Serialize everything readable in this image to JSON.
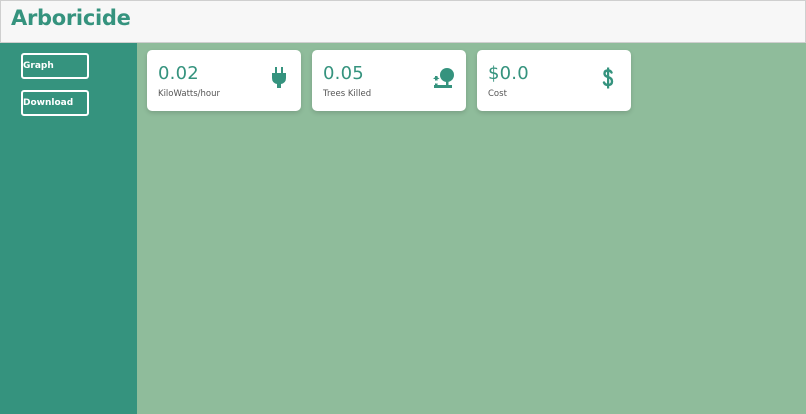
{
  "app": {
    "title": "Arboricide"
  },
  "sidebar": {
    "buttons": [
      {
        "label": "Graph"
      },
      {
        "label": "Download"
      }
    ]
  },
  "cards": [
    {
      "value": "0.02",
      "label": "KiloWatts/hour",
      "icon": "plug-icon"
    },
    {
      "value": "0.05",
      "label": "Trees Killed",
      "icon": "tree-icon"
    },
    {
      "value": "$0.0",
      "label": "Cost",
      "icon": "dollar-icon"
    }
  ],
  "colors": {
    "accent": "#35937e",
    "background": "#8fbc9b",
    "header": "#f7f7f7",
    "card": "#ffffff"
  }
}
